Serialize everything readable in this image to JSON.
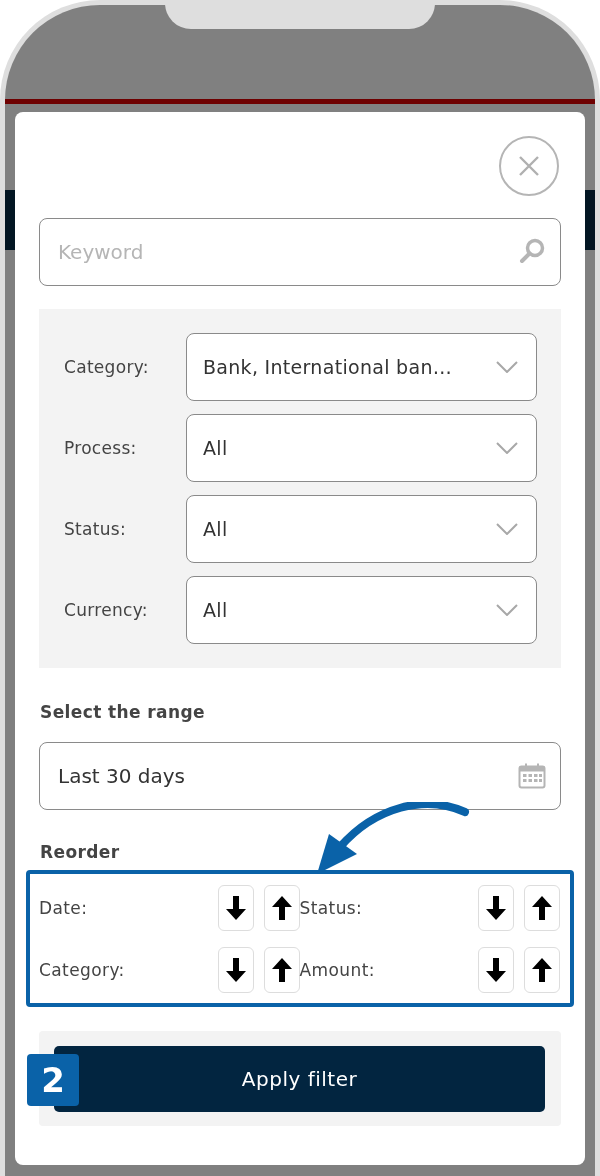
{
  "search": {
    "placeholder": "Keyword"
  },
  "filters": [
    {
      "label": "Category:",
      "value": "Bank, International ban…"
    },
    {
      "label": "Process:",
      "value": "All"
    },
    {
      "label": "Status:",
      "value": "All"
    },
    {
      "label": "Currency:",
      "value": "All"
    }
  ],
  "range": {
    "title": "Select the range",
    "value": "Last 30 days"
  },
  "reorder": {
    "title": "Reorder",
    "items": [
      {
        "label": "Date:"
      },
      {
        "label": "Status:"
      },
      {
        "label": "Category:"
      },
      {
        "label": "Amount:"
      }
    ]
  },
  "apply_button": "Apply filter",
  "step_badge": "2"
}
